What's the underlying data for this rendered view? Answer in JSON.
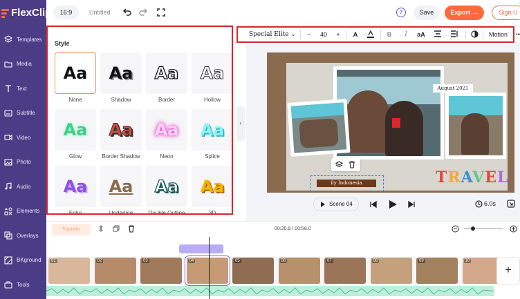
{
  "app": {
    "logo_text": "FlexClip"
  },
  "nav": {
    "items": [
      {
        "label": "Templates",
        "icon": "layers-icon"
      },
      {
        "label": "Media",
        "icon": "folder-icon"
      },
      {
        "label": "Text",
        "icon": "text-icon"
      },
      {
        "label": "Subtitle",
        "icon": "subtitle-icon"
      },
      {
        "label": "Video",
        "icon": "video-icon"
      },
      {
        "label": "Photo",
        "icon": "photo-icon"
      },
      {
        "label": "Audio",
        "icon": "music-icon"
      },
      {
        "label": "Elements",
        "icon": "elements-icon"
      },
      {
        "label": "Overlays",
        "icon": "overlays-icon"
      },
      {
        "label": "BKground",
        "icon": "background-icon"
      },
      {
        "label": "Tools",
        "icon": "tools-icon"
      }
    ]
  },
  "topbar": {
    "ratio": "16:9",
    "title": "Untitled",
    "help": "?",
    "save": "Save",
    "export": "Export →",
    "signup": "Sign U"
  },
  "style_panel": {
    "heading": "Style",
    "tiles_text": "Aa",
    "styles": [
      "None",
      "Shadow",
      "Border",
      "Hollow",
      "Glow",
      "Border Shadow",
      "Neon",
      "Splice",
      "Echo",
      "Underline",
      "Double Outline",
      "3D"
    ]
  },
  "text_toolbar": {
    "font": "Special Elite",
    "size": "40",
    "minus": "−",
    "plus": "+",
    "bold": "B",
    "italic": "I",
    "case": "aA",
    "motion": "Motion",
    "more": "•••"
  },
  "canvas": {
    "caption": "August 2021",
    "selected_text": "ily Indonesia",
    "sticker": "TRAVEL"
  },
  "player": {
    "scene": "Scene 04",
    "duration": "6.0s"
  },
  "timeline": {
    "transfer_label": "Transfer",
    "time": "00:20.9 / 00:58.0",
    "add": "+",
    "clips": [
      "01",
      "02",
      "03",
      "04",
      "05",
      "06",
      "07",
      "08",
      "09",
      "10"
    ]
  },
  "colors": {
    "accent": "#ff6a3d",
    "nav": "#4b3c86",
    "highlight": "#d9272d",
    "purple": "#6a53d9"
  }
}
